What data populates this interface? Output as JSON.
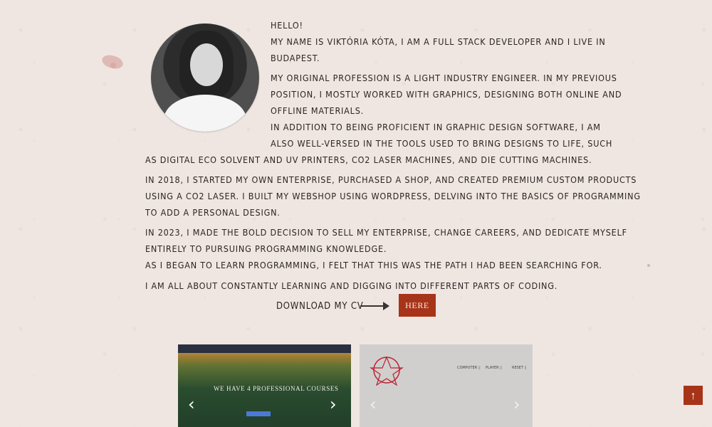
{
  "about": {
    "lines": [
      "HELLO!",
      "MY NAME IS VIKTÓRIA KÓTA, I AM A FULL STACK DEVELOPER AND I LIVE IN",
      "BUDAPEST.",
      "MY ORIGINAL PROFESSION IS A LIGHT INDUSTRY ENGINEER. IN MY PREVIOUS",
      "POSITION, I MOSTLY WORKED WITH GRAPHICS, DESIGNING BOTH ONLINE AND",
      "OFFLINE MATERIALS.",
      "IN ADDITION TO BEING PROFICIENT IN GRAPHIC DESIGN SOFTWARE, I AM",
      "ALSO WELL-VERSED IN THE TOOLS USED TO BRING DESIGNS TO LIFE, SUCH",
      "AS DIGITAL ECO SOLVENT AND UV PRINTERS, CO2 LASER MACHINES, AND DIE CUTTING MACHINES.",
      "IN 2018, I STARTED MY OWN ENTERPRISE, PURCHASED A SHOP, AND CREATED PREMIUM CUSTOM PRODUCTS",
      "USING A CO2 LASER. I BUILT MY WEBSHOP USING WORDPRESS, DELVING INTO THE BASICS OF PROGRAMMING",
      "TO ADD A PERSONAL DESIGN.",
      "IN 2023, I MADE THE BOLD DECISION TO SELL MY ENTERPRISE, CHANGE CAREERS, AND DEDICATE MYSELF",
      "ENTIRELY TO PURSUING PROGRAMMING KNOWLEDGE.",
      "AS I BEGAN TO LEARN PROGRAMMING, I FELT THAT THIS WAS THE PATH I HAD BEEN SEARCHING FOR.",
      "I AM ALL ABOUT CONSTANTLY LEARNING AND DIGGING INTO DIFFERENT PARTS OF CODING."
    ]
  },
  "cv": {
    "label": "DOWNLOAD MY CV",
    "button": "HERE"
  },
  "projects": {
    "golf_title": "WE HAVE 4 PROFESSIONAL COURSES",
    "right_nav": [
      "COMPUTER ▯",
      "PLAYER ▯",
      "RESET ▯"
    ]
  },
  "icons": {
    "scroll_top": "arrow-up-icon"
  }
}
